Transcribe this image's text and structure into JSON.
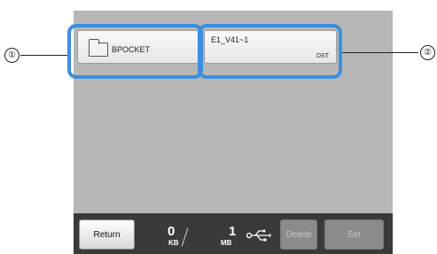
{
  "folder_item": {
    "label": "BPOCKET",
    "icon": "folder-icon"
  },
  "file_item": {
    "name": "E1_V41~1",
    "extension": "DST"
  },
  "callouts": {
    "one": "①",
    "two": "②"
  },
  "bottom_bar": {
    "return_label": "Return",
    "used": {
      "value": "0",
      "unit": "KB"
    },
    "capacity": {
      "value": "1",
      "unit": "MB"
    },
    "delete_label": "Delete",
    "set_label": "Set",
    "usb_icon": "usb-icon"
  },
  "colors": {
    "highlight": "#3a8fe0",
    "screen_background": "#b7b7b7",
    "bottom_bar": "#3a3a3a",
    "disabled_button": "#8b8b8b"
  }
}
